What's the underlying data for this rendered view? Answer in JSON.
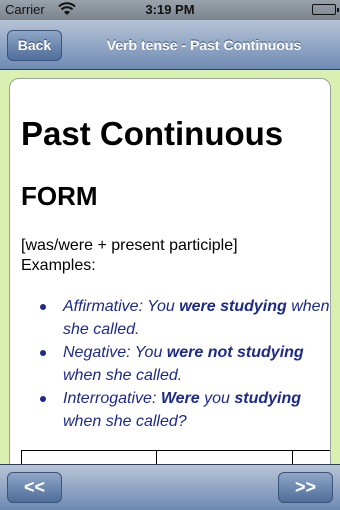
{
  "status_bar": {
    "carrier": "Carrier",
    "time": "3:19 PM"
  },
  "nav": {
    "back_label": "Back",
    "title": "Verb tense - Past Continuous"
  },
  "content": {
    "title": "Past Continuous",
    "form_heading": "FORM",
    "form_line": "[was/were + present participle]",
    "examples_label": "Examples:",
    "examples": [
      {
        "prefix": "Affirmative: You ",
        "bold": "were studying",
        "suffix": " when she called."
      },
      {
        "prefix": "Negative: You ",
        "bold": "were not studying",
        "suffix": " when she called."
      },
      {
        "prefix": "Interrogative: ",
        "bold": "Were",
        "middle": " you ",
        "bold2": "studying",
        "suffix": " when she called?"
      }
    ]
  },
  "toolbar": {
    "prev_label": "<<",
    "next_label": ">>"
  }
}
